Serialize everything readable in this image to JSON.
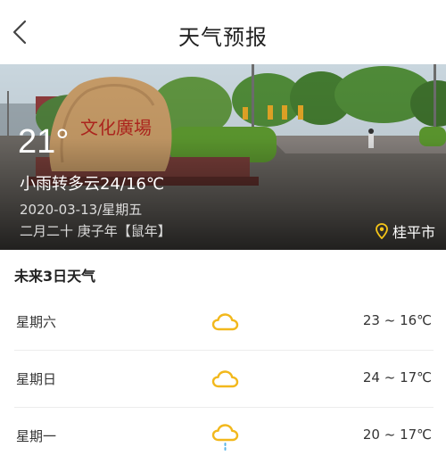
{
  "header": {
    "title": "天气预报",
    "back_icon": "chevron-left-icon"
  },
  "current": {
    "temperature": "21°",
    "condition": "小雨转多云24/16℃",
    "date": "2020-03-13/星期五",
    "lunar": "二月二十 庚子年【鼠年】",
    "location": "桂平市",
    "location_icon": "map-pin-icon",
    "hero_inscription": "文化廣場"
  },
  "forecast": {
    "title": "未来3日天气",
    "days": [
      {
        "day": "星期六",
        "icon": "cloudy-icon",
        "range": "23 ~ 16℃"
      },
      {
        "day": "星期日",
        "icon": "cloudy-icon",
        "range": "24 ~ 17℃"
      },
      {
        "day": "星期一",
        "icon": "light-rain-icon",
        "range": "20 ~ 17℃"
      }
    ]
  },
  "colors": {
    "icon_yellow": "#f2b81c",
    "rain_blue": "#5ab4e8",
    "pin_yellow": "#f5c518"
  }
}
